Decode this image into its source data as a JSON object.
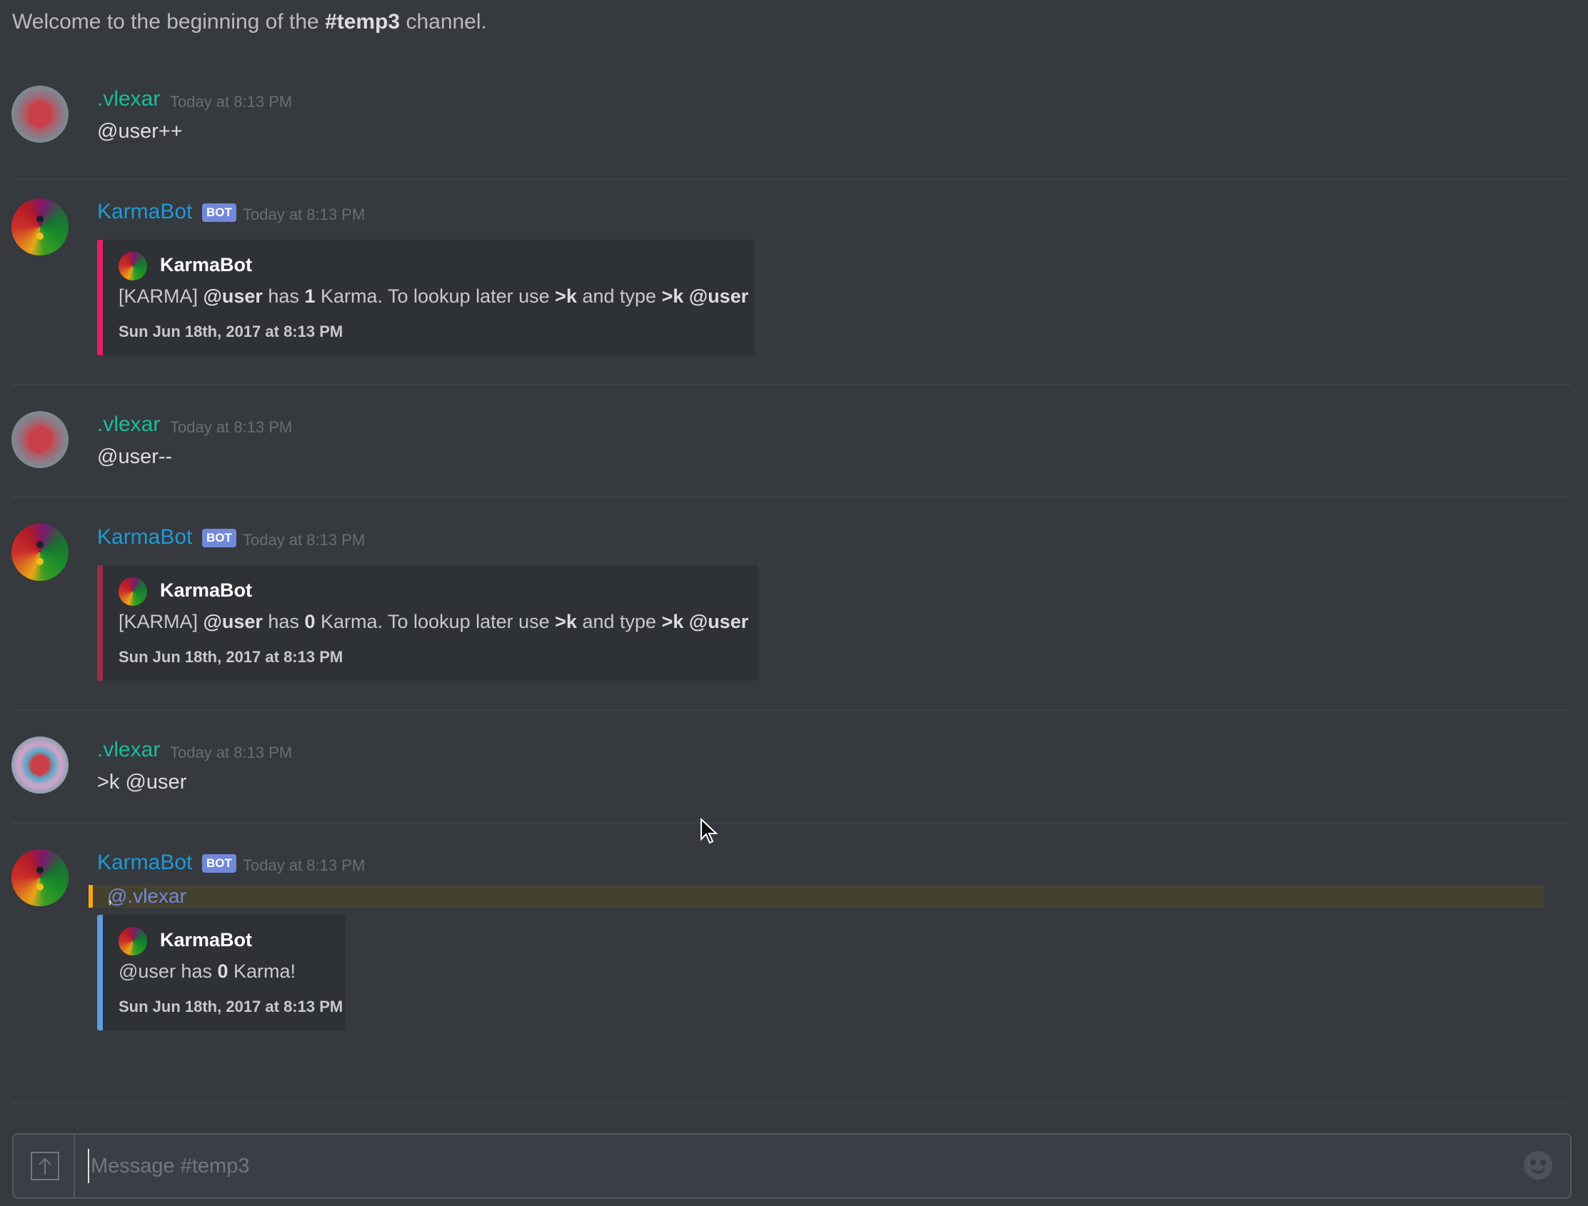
{
  "channel": {
    "welcome_prefix": "Welcome to the beginning of the ",
    "channel_name": "#temp3",
    "welcome_suffix": " channel."
  },
  "messages": [
    {
      "author": ".vlexar",
      "timestamp": "Today at 8:13 PM",
      "text": "@user++"
    },
    {
      "author": "KarmaBot",
      "bot_tag": "BOT",
      "timestamp": "Today at 8:13 PM",
      "embed": {
        "author": "KarmaBot",
        "desc_parts": [
          "[KARMA] ",
          "@user",
          " has ",
          "1",
          " Karma. To lookup later use ",
          ">k",
          " and type ",
          ">k @user"
        ],
        "footer": "Sun Jun 18th, 2017 at 8:13 PM",
        "color": "#e91e63"
      }
    },
    {
      "author": ".vlexar",
      "timestamp": "Today at 8:13 PM",
      "text": "@user--"
    },
    {
      "author": "KarmaBot",
      "bot_tag": "BOT",
      "timestamp": "Today at 8:13 PM",
      "embed": {
        "author": "KarmaBot",
        "desc_parts": [
          "[KARMA] ",
          "@user",
          " has ",
          "0",
          " Karma. To lookup later use ",
          ">k",
          " and type ",
          ">k @user"
        ],
        "footer": "Sun Jun 18th, 2017 at 8:13 PM",
        "color": "#992d4a"
      }
    },
    {
      "author": ".vlexar",
      "timestamp": "Today at 8:13 PM",
      "text": ">k @user"
    },
    {
      "author": "KarmaBot",
      "bot_tag": "BOT",
      "timestamp": "Today at 8:13 PM",
      "mention": "@.vlexar",
      "mention_suffix": ",",
      "embed": {
        "author": "KarmaBot",
        "desc_parts": [
          "@user has ",
          "0",
          " Karma!"
        ],
        "footer": "Sun Jun 18th, 2017 at 8:13 PM",
        "color": "#5c9fe0"
      }
    }
  ],
  "composer": {
    "placeholder": "Message #temp3",
    "upload_icon": "upload-icon",
    "emoji_icon": "emoji-icon"
  },
  "colors": {
    "background": "#36393e",
    "user_name": "#1abc9c",
    "bot_name": "#1e9ad6",
    "bot_tag": "#7289da",
    "mention_highlight": "#faa61a"
  }
}
